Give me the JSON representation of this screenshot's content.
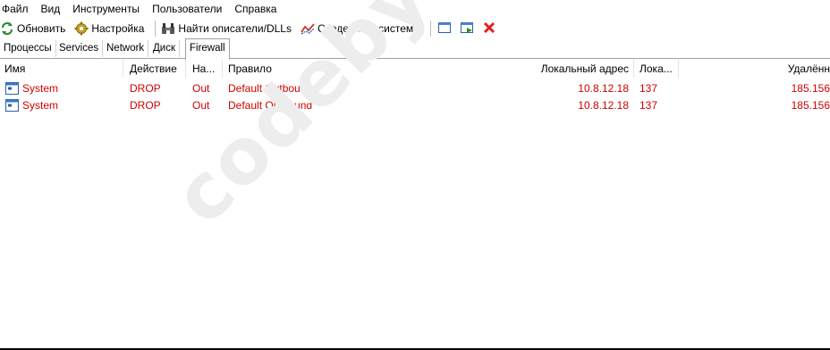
{
  "menubar": {
    "items": [
      {
        "label": "Файл"
      },
      {
        "label": "Вид"
      },
      {
        "label": "Инструменты"
      },
      {
        "label": "Пользователи"
      },
      {
        "label": "Справка"
      }
    ]
  },
  "toolbar": {
    "refresh_label": "Обновить",
    "options_label": "Настройка",
    "find_label": "Найти описатели/DLLs",
    "sysinfo_label": "Сведения о системе"
  },
  "tabs": [
    {
      "label": "Процессы",
      "active": false
    },
    {
      "label": "Services",
      "active": false
    },
    {
      "label": "Network",
      "active": false
    },
    {
      "label": "Диск",
      "active": false
    },
    {
      "label": "Firewall",
      "active": true
    }
  ],
  "columns": {
    "name": "Имя",
    "action": "Действие",
    "direction": "На...",
    "rule": "Правило",
    "local_address": "Локальный адрес",
    "local_port": "Лока...",
    "remote": "Удалённ"
  },
  "rows": [
    {
      "name": "System",
      "action": "DROP",
      "direction": "Out",
      "rule": "Default Outbound",
      "local_address": "10.8.12.18",
      "local_port": "137",
      "remote": "185.156"
    },
    {
      "name": "System",
      "action": "DROP",
      "direction": "Out",
      "rule": "Default Outbound",
      "local_address": "10.8.12.18",
      "local_port": "137",
      "remote": "185.156"
    }
  ],
  "watermark": "codeby.net",
  "colors": {
    "row_text": "#d00000",
    "watermark": "#ededed"
  }
}
